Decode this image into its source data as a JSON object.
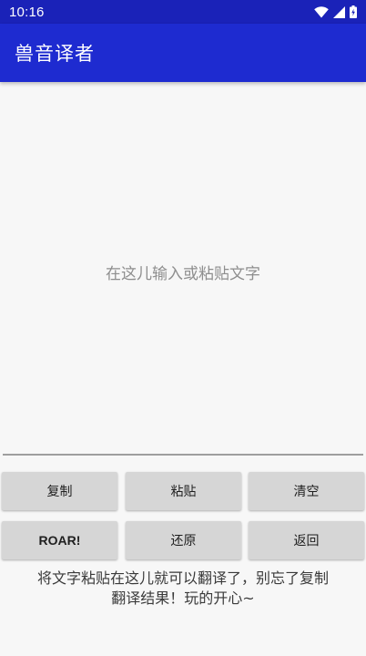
{
  "status_bar": {
    "time": "10:16",
    "icons": [
      "wifi-icon",
      "cellular-signal-icon",
      "battery-icon"
    ]
  },
  "app_bar": {
    "title": "兽音译者"
  },
  "editor": {
    "value": "",
    "placeholder": "在这儿输入或粘贴文字"
  },
  "buttons": {
    "copy": "复制",
    "paste": "粘贴",
    "clear": "清空",
    "roar": "ROAR!",
    "restore": "还原",
    "back": "返回"
  },
  "hint": {
    "line1": "将文字粘贴在这儿就可以翻译了，别忘了复制",
    "line2": "翻译结果！玩的开心~"
  },
  "colors": {
    "status_bar": "#1a22b8",
    "app_bar": "#1e2bd0",
    "background": "#f7f7f7",
    "button": "#d6d6d6"
  }
}
